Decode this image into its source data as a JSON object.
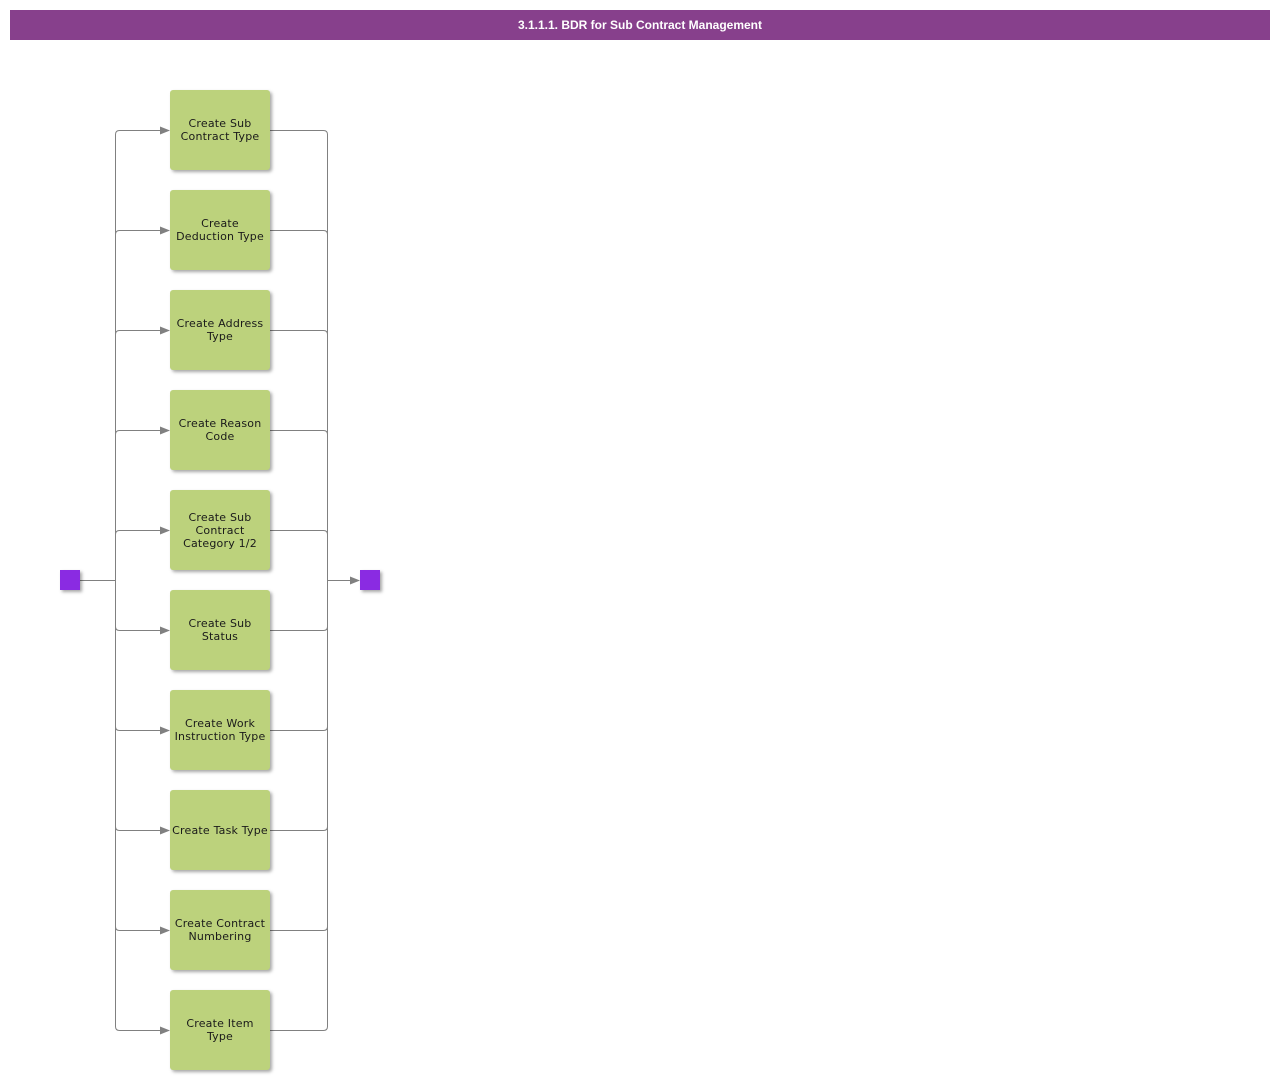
{
  "title": "3.1.1.1. BDR for Sub Contract Management",
  "colors": {
    "title_bar": "#87408c",
    "task_fill": "#bcd27c",
    "terminal_fill": "#8a2be2",
    "connector": "#808080"
  },
  "start_node": {
    "type": "start"
  },
  "end_node": {
    "type": "end"
  },
  "tasks": [
    {
      "label": "Create Sub Contract Type"
    },
    {
      "label": "Create Deduction Type"
    },
    {
      "label": "Create Address Type"
    },
    {
      "label": "Create Reason Code"
    },
    {
      "label": "Create Sub Contract Category 1/2"
    },
    {
      "label": "Create Sub Status"
    },
    {
      "label": "Create Work Instruction Type"
    },
    {
      "label": "Create Task Type"
    },
    {
      "label": "Create Contract Numbering"
    },
    {
      "label": "Create Item Type"
    }
  ]
}
